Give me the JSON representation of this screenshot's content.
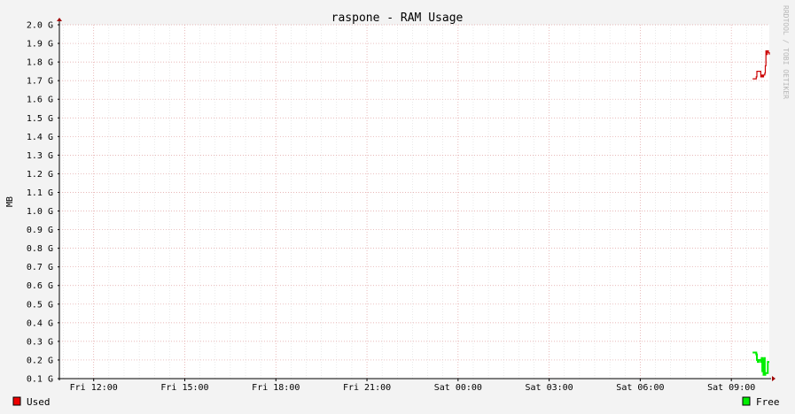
{
  "title": "raspone - RAM Usage",
  "watermark": "RRDTOOL / TOBI OETIKER",
  "colors": {
    "used": "#cc0000",
    "free": "#00ee00",
    "grid_major": "#e0a0a0",
    "grid_minor": "#dcdcdc",
    "axis": "#000000",
    "canvas": "#ffffff",
    "background": "#f3f3f3",
    "arrow": "#a00000"
  },
  "chart_data": {
    "type": "line",
    "ylabel": "MB",
    "yunit_label": "G",
    "ylim": [
      0.1,
      2.0
    ],
    "yticks": [
      "2.0 G",
      "1.9 G",
      "1.8 G",
      "1.7 G",
      "1.6 G",
      "1.5 G",
      "1.4 G",
      "1.3 G",
      "1.2 G",
      "1.1 G",
      "1.0 G",
      "0.9 G",
      "0.8 G",
      "0.7 G",
      "0.6 G",
      "0.5 G",
      "0.4 G",
      "0.3 G",
      "0.2 G",
      "0.1 G"
    ],
    "xlim_hours": [
      10.87,
      34.25
    ],
    "xticks": [
      {
        "label": "Fri 12:00",
        "hour": 12
      },
      {
        "label": "Fri 15:00",
        "hour": 15
      },
      {
        "label": "Fri 18:00",
        "hour": 18
      },
      {
        "label": "Fri 21:00",
        "hour": 21
      },
      {
        "label": "Sat 00:00",
        "hour": 24
      },
      {
        "label": "Sat 03:00",
        "hour": 27
      },
      {
        "label": "Sat 06:00",
        "hour": 30
      },
      {
        "label": "Sat 09:00",
        "hour": 33
      }
    ],
    "series": [
      {
        "name": "Used",
        "color": "#cc0000",
        "x": [
          33.7,
          33.78,
          33.82,
          33.84,
          33.94,
          33.97,
          34.0,
          34.03,
          34.06,
          34.1,
          34.12,
          34.14,
          34.16,
          34.18,
          34.2,
          34.22,
          34.25
        ],
        "y": [
          1.71,
          1.71,
          1.72,
          1.75,
          1.75,
          1.72,
          1.73,
          1.72,
          1.73,
          1.74,
          1.78,
          1.86,
          1.84,
          1.86,
          1.86,
          1.85,
          1.84
        ]
      },
      {
        "name": "Free",
        "color": "#00ee00",
        "x": [
          33.7,
          33.78,
          33.82,
          33.84,
          33.87,
          33.9,
          33.94,
          33.97,
          34.0,
          34.02,
          34.04,
          34.06,
          34.08,
          34.1,
          34.12,
          34.15,
          34.17,
          34.2,
          34.22,
          34.25
        ],
        "y": [
          0.24,
          0.24,
          0.23,
          0.2,
          0.19,
          0.2,
          0.2,
          0.19,
          0.21,
          0.14,
          0.2,
          0.12,
          0.21,
          0.12,
          0.13,
          0.13,
          0.13,
          0.19,
          0.19,
          0.19
        ]
      }
    ],
    "legend": [
      {
        "label": "Used",
        "color": "#ee0000",
        "position": "bottom-left"
      },
      {
        "label": "Free",
        "color": "#00ee00",
        "position": "bottom-right"
      }
    ],
    "grid": true
  }
}
